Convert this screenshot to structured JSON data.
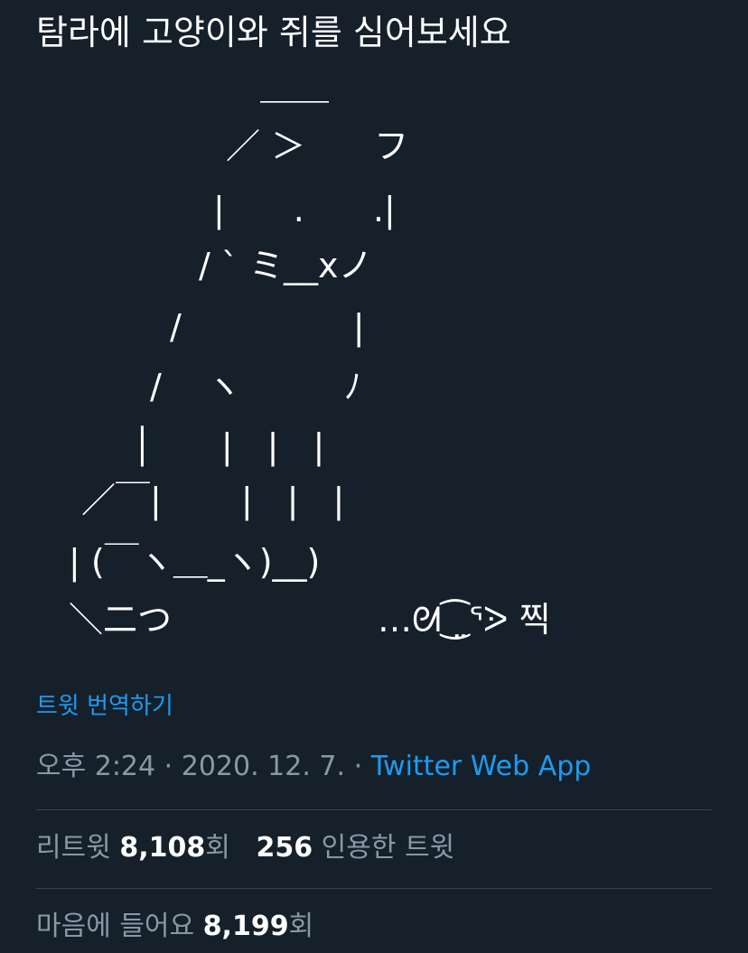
{
  "tweet": {
    "text": "탐라에 고양이와 쥐를 심어보세요",
    "ascii_art": [
      "            ＿＿",
      "         ／ ＞　　フ",
      "         |  　_　_|",
      "       ／` ミ＿xノ",
      "      /　　　　 |",
      "     /　 ヽ　　 ﾉ",
      "     │　　|　|　|",
      "  ／￣|　　 |　|　|",
      "  | (￣ヽ＿_ヽ_)__)",
      "  ＼二つ　　　　　　…ᘛ⁐̤ᕐᐷ 찍"
    ],
    "translate_label": "트윗 번역하기",
    "time": "오후 2:24",
    "separator1": "·",
    "date": "2020. 12. 7.",
    "separator2": "·",
    "source": "Twitter Web App"
  },
  "stats": {
    "retweets_label": "리트윗",
    "retweets_count": "8,108",
    "retweets_unit": "회",
    "quotes_count": "256",
    "quotes_label": "인용한 트윗",
    "likes_label": "마음에 들어요",
    "likes_count": "8,199",
    "likes_unit": "회"
  },
  "colors": {
    "background": "#15202b",
    "text": "#ffffff",
    "secondary_text": "#8899a6",
    "link": "#1d9bf0",
    "divider": "#38444d"
  }
}
